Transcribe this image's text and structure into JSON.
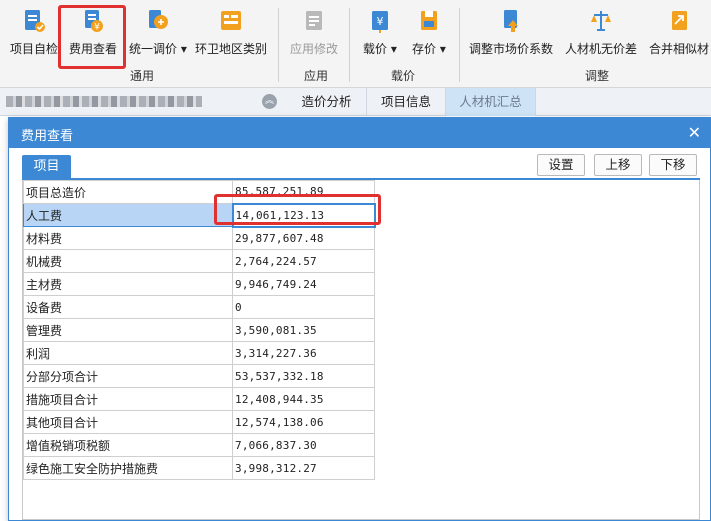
{
  "ribbon": {
    "buttons": [
      {
        "label": "项目自检",
        "icon": "project-check-icon"
      },
      {
        "label": "费用查看",
        "icon": "cost-view-icon"
      },
      {
        "label": "统一调价",
        "icon": "unified-price-icon"
      },
      {
        "label": "环卫地区类别",
        "icon": "sanitation-region-icon"
      },
      {
        "label": "应用修改",
        "icon": "apply-changes-icon"
      },
      {
        "label": "载价",
        "icon": "load-price-icon"
      },
      {
        "label": "存价",
        "icon": "save-price-icon"
      },
      {
        "label": "调整市场价系数",
        "icon": "adjust-coefficient-icon"
      },
      {
        "label": "人材机无价差",
        "icon": "no-price-diff-icon"
      },
      {
        "label": "合并相似材",
        "icon": "merge-similar-icon"
      }
    ],
    "groups": {
      "general": "通用",
      "apply": "应用",
      "load_price": "载价",
      "adjust": "调整"
    }
  },
  "tabs": [
    "造价分析",
    "项目信息",
    "人材机汇总"
  ],
  "dialog": {
    "title": "费用查看",
    "tab": "项目",
    "settings_label": "设置",
    "move_up_label": "上移",
    "move_down_label": "下移",
    "rows": [
      {
        "name": "项目总造价",
        "value": "85,587,251.89"
      },
      {
        "name": "人工费",
        "value": "14,061,123.13"
      },
      {
        "name": "材料费",
        "value": "29,877,607.48"
      },
      {
        "name": "机械费",
        "value": "2,764,224.57"
      },
      {
        "name": "主材费",
        "value": "9,946,749.24"
      },
      {
        "name": "设备费",
        "value": "0"
      },
      {
        "name": "管理费",
        "value": "3,590,081.35"
      },
      {
        "name": "利润",
        "value": "3,314,227.36"
      },
      {
        "name": "分部分项合计",
        "value": "53,537,332.18"
      },
      {
        "name": "措施项目合计",
        "value": "12,408,944.35"
      },
      {
        "name": "其他项目合计",
        "value": "12,574,138.06"
      },
      {
        "name": "增值税销项税额",
        "value": "7,066,837.30"
      },
      {
        "name": "绿色施工安全防护措施费",
        "value": "3,998,312.27"
      }
    ]
  },
  "colors": {
    "accent": "#3c88d4",
    "highlight": "#e03030",
    "selected_row": "#b8d5f5"
  }
}
